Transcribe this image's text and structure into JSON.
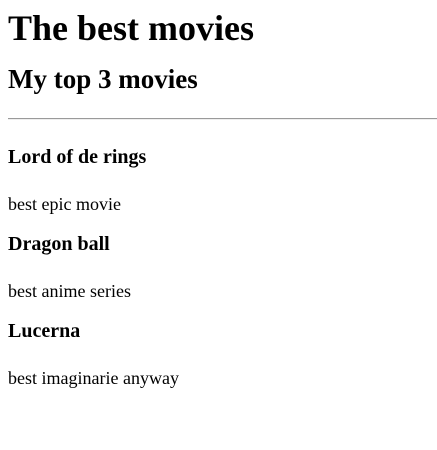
{
  "page": {
    "title": "The best movies",
    "subtitle": "My top 3 movies"
  },
  "movies": [
    {
      "title": "Lord of de rings",
      "description": "best epic movie"
    },
    {
      "title": "Dragon ball",
      "description": "best anime series"
    },
    {
      "title": "Lucerna",
      "description": "best imaginarie anyway"
    }
  ]
}
